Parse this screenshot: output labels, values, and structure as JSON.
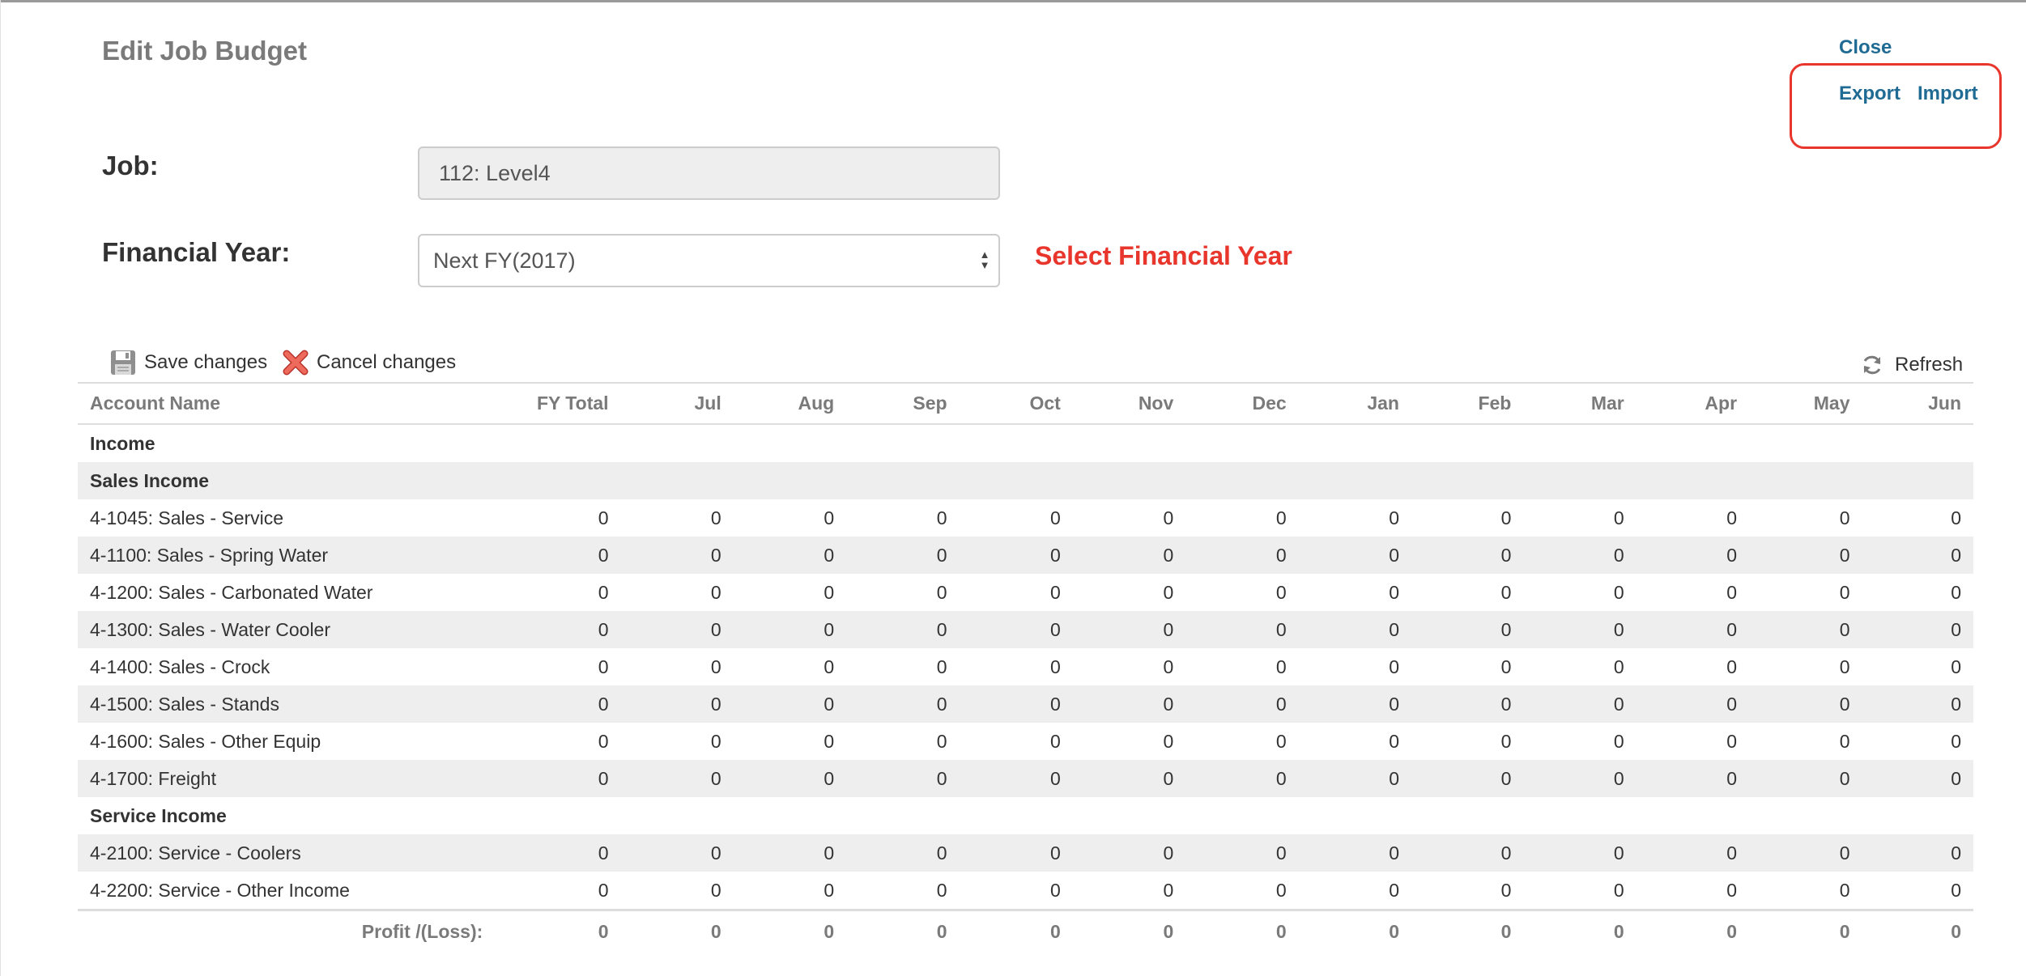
{
  "page": {
    "title": "Edit Job Budget"
  },
  "actions": {
    "close": "Close",
    "export": "Export",
    "import": "Import"
  },
  "form": {
    "job_label": "Job:",
    "job_value": "112: Level4",
    "fy_label": "Financial Year:",
    "fy_value": "Next FY(2017)",
    "fy_hint": "Select Financial Year"
  },
  "toolbar": {
    "save": "Save changes",
    "cancel": "Cancel changes",
    "refresh": "Refresh"
  },
  "table": {
    "columns": [
      "Account Name",
      "FY Total",
      "Jul",
      "Aug",
      "Sep",
      "Oct",
      "Nov",
      "Dec",
      "Jan",
      "Feb",
      "Mar",
      "Apr",
      "May",
      "Jun"
    ],
    "rows": [
      {
        "type": "group",
        "label": "Income"
      },
      {
        "type": "group",
        "label": "Sales Income"
      },
      {
        "type": "account",
        "label": "4-1045: Sales - Service",
        "values": [
          "0",
          "0",
          "0",
          "0",
          "0",
          "0",
          "0",
          "0",
          "0",
          "0",
          "0",
          "0",
          "0"
        ]
      },
      {
        "type": "account",
        "label": "4-1100: Sales - Spring Water",
        "values": [
          "0",
          "0",
          "0",
          "0",
          "0",
          "0",
          "0",
          "0",
          "0",
          "0",
          "0",
          "0",
          "0"
        ]
      },
      {
        "type": "account",
        "label": "4-1200: Sales - Carbonated Water",
        "values": [
          "0",
          "0",
          "0",
          "0",
          "0",
          "0",
          "0",
          "0",
          "0",
          "0",
          "0",
          "0",
          "0"
        ]
      },
      {
        "type": "account",
        "label": "4-1300: Sales - Water Cooler",
        "values": [
          "0",
          "0",
          "0",
          "0",
          "0",
          "0",
          "0",
          "0",
          "0",
          "0",
          "0",
          "0",
          "0"
        ]
      },
      {
        "type": "account",
        "label": "4-1400: Sales - Crock",
        "values": [
          "0",
          "0",
          "0",
          "0",
          "0",
          "0",
          "0",
          "0",
          "0",
          "0",
          "0",
          "0",
          "0"
        ]
      },
      {
        "type": "account",
        "label": "4-1500: Sales - Stands",
        "values": [
          "0",
          "0",
          "0",
          "0",
          "0",
          "0",
          "0",
          "0",
          "0",
          "0",
          "0",
          "0",
          "0"
        ]
      },
      {
        "type": "account",
        "label": "4-1600: Sales - Other Equip",
        "values": [
          "0",
          "0",
          "0",
          "0",
          "0",
          "0",
          "0",
          "0",
          "0",
          "0",
          "0",
          "0",
          "0"
        ]
      },
      {
        "type": "account",
        "label": "4-1700: Freight",
        "values": [
          "0",
          "0",
          "0",
          "0",
          "0",
          "0",
          "0",
          "0",
          "0",
          "0",
          "0",
          "0",
          "0"
        ]
      },
      {
        "type": "group",
        "label": "Service Income"
      },
      {
        "type": "account",
        "label": "4-2100: Service - Coolers",
        "values": [
          "0",
          "0",
          "0",
          "0",
          "0",
          "0",
          "0",
          "0",
          "0",
          "0",
          "0",
          "0",
          "0"
        ]
      },
      {
        "type": "account",
        "label": "4-2200: Service - Other Income",
        "values": [
          "0",
          "0",
          "0",
          "0",
          "0",
          "0",
          "0",
          "0",
          "0",
          "0",
          "0",
          "0",
          "0"
        ]
      }
    ],
    "total": {
      "label": "Profit /(Loss):",
      "values": [
        "0",
        "0",
        "0",
        "0",
        "0",
        "0",
        "0",
        "0",
        "0",
        "0",
        "0",
        "0",
        "0"
      ]
    }
  }
}
